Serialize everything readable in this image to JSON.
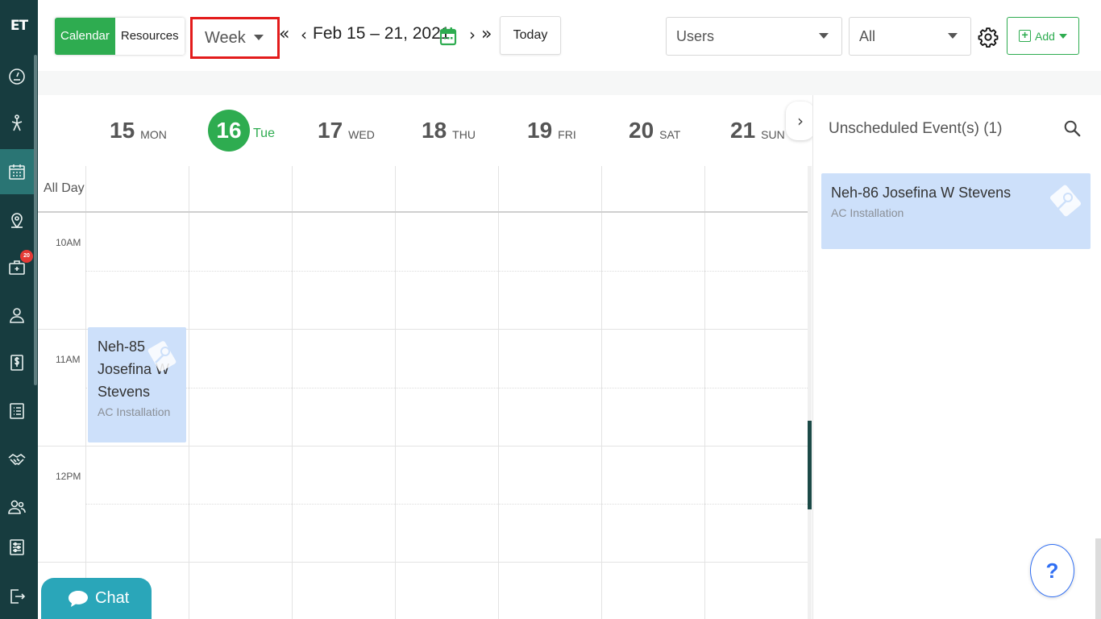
{
  "app": {
    "logo_text": "ET",
    "colors": {
      "sidebar": "#173c3f",
      "accent": "#2eac50",
      "highlight": "#e31b1b",
      "event_bg": "#cde0fa",
      "chat": "#2aa6b9"
    }
  },
  "sidebar": {
    "items": [
      {
        "icon": "dashboard-icon"
      },
      {
        "icon": "dispatch-icon"
      },
      {
        "icon": "calendar-icon",
        "active": true
      },
      {
        "icon": "map-pin-icon"
      },
      {
        "icon": "jobs-icon",
        "badge": "20"
      },
      {
        "icon": "customer-icon"
      },
      {
        "icon": "invoice-icon"
      },
      {
        "icon": "list-icon"
      },
      {
        "icon": "handshake-icon"
      },
      {
        "icon": "team-icon"
      },
      {
        "icon": "settings-sliders-icon"
      },
      {
        "icon": "logout-icon"
      }
    ]
  },
  "toolbar": {
    "view_tabs": [
      "Calendar",
      "Resources"
    ],
    "active_view": "Calendar",
    "range_select": "Week",
    "date_range": "Feb 15 – 21, 2021",
    "today_label": "Today",
    "users_select": "Users",
    "filter_select": "All",
    "add_label": "Add"
  },
  "calendar": {
    "days": [
      {
        "num": "15",
        "name": "MON"
      },
      {
        "num": "16",
        "name": "Tue",
        "today": true
      },
      {
        "num": "17",
        "name": "WED"
      },
      {
        "num": "18",
        "name": "THU"
      },
      {
        "num": "19",
        "name": "FRI"
      },
      {
        "num": "20",
        "name": "SAT"
      },
      {
        "num": "21",
        "name": "SUN"
      }
    ],
    "all_day_label": "All Day",
    "time_labels": [
      "10AM",
      "11AM",
      "12PM"
    ],
    "events": [
      {
        "title": "Neh-85 Josefina W Stevens",
        "subtitle": "AC Installation",
        "day": "15",
        "start": "11AM"
      }
    ]
  },
  "unscheduled": {
    "title": "Unscheduled Event(s) (1)",
    "events": [
      {
        "title": "Neh-86 Josefina W Stevens",
        "subtitle": "AC Installation"
      }
    ]
  },
  "help_label": "?",
  "chat_label": "Chat"
}
